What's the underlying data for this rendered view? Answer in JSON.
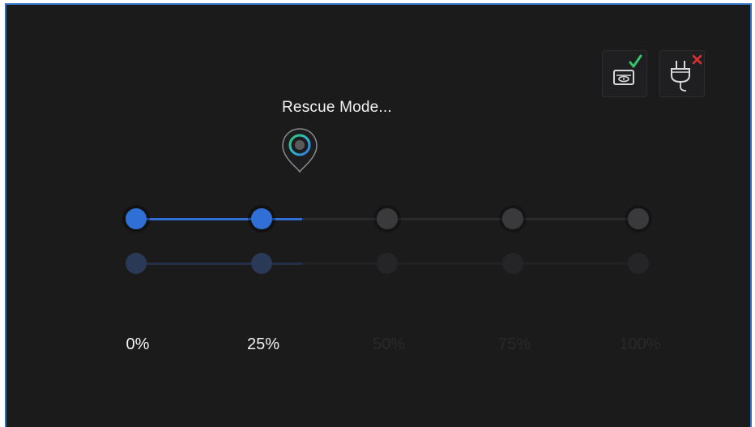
{
  "rescue": {
    "title": "Rescue Mode...",
    "progress_fraction": 0.33
  },
  "status_icons": [
    {
      "name": "disc-drive-icon",
      "state": "ok",
      "mark": "checkmark"
    },
    {
      "name": "power-plug-icon",
      "state": "error",
      "mark": "cross"
    }
  ],
  "steps": [
    {
      "label": "0%",
      "reached": true
    },
    {
      "label": "25%",
      "reached": true
    },
    {
      "label": "50%",
      "reached": false
    },
    {
      "label": "75%",
      "reached": false
    },
    {
      "label": "100%",
      "reached": false
    }
  ],
  "colors": {
    "background": "#1b1b1c",
    "accent": "#2f6fd6",
    "accent_dim": "#2a3a56",
    "inactive": "#3a3a3c",
    "check": "#35c46a",
    "cross": "#e03131"
  },
  "icons": {
    "location_pin": "location-pin-icon",
    "status_ring": "status-ring-icon"
  }
}
